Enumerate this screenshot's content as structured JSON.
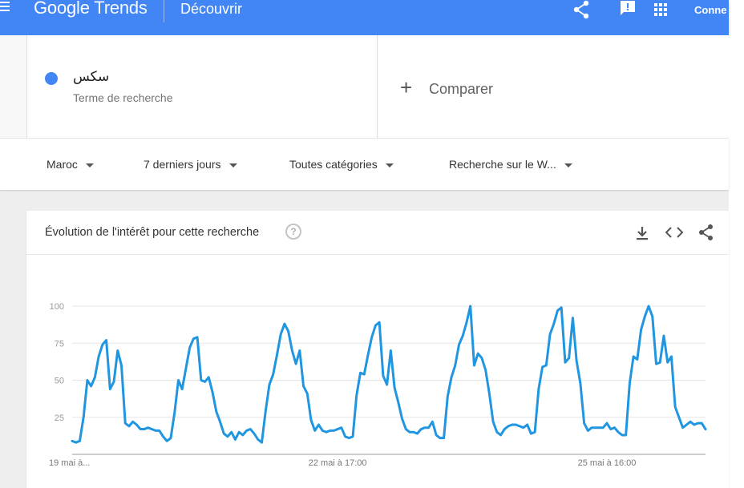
{
  "topbar": {
    "logo_google": "Google",
    "logo_trends": "Trends",
    "section": "Découvrir",
    "connect_label": "Conne",
    "icons": [
      "menu-icon",
      "share-icon",
      "feedback-icon",
      "apps-icon"
    ]
  },
  "term": {
    "name": "سكس",
    "subtitle": "Terme de recherche",
    "color": "#4285f4"
  },
  "compare": {
    "label": "Comparer"
  },
  "filters": [
    {
      "label": "Maroc"
    },
    {
      "label": "7 derniers jours"
    },
    {
      "label": "Toutes catégories"
    },
    {
      "label": "Recherche sur le W..."
    }
  ],
  "card": {
    "title": "Évolution de l'intérêt pour cette recherche",
    "help_label": "?",
    "icons": [
      "download-icon",
      "embed-icon",
      "share-icon"
    ]
  },
  "chart_data": {
    "type": "line",
    "color": "#2196e0",
    "ylim": [
      0,
      100
    ],
    "yticks": [
      25,
      50,
      75,
      100
    ],
    "ytick_labels": [
      "25",
      "50",
      "75",
      "100"
    ],
    "xtick_labels": [
      {
        "label": "19 mai à...",
        "index": 0
      },
      {
        "label": "22 mai à 17:00",
        "index": 70
      },
      {
        "label": "25 mai à 16:00",
        "index": 141
      }
    ],
    "grid": true,
    "values": [
      9,
      8,
      9,
      25,
      50,
      46,
      52,
      66,
      74,
      77,
      44,
      49,
      70,
      60,
      21,
      19,
      22,
      20,
      17,
      17,
      18,
      17,
      16,
      16,
      12,
      9,
      11,
      28,
      50,
      44,
      58,
      72,
      78,
      79,
      50,
      49,
      52,
      42,
      29,
      22,
      14,
      12,
      15,
      10,
      15,
      13,
      16,
      17,
      14,
      10,
      8,
      29,
      47,
      54,
      67,
      81,
      88,
      83,
      70,
      61,
      70,
      46,
      41,
      23,
      16,
      20,
      16,
      15,
      16,
      16,
      17,
      18,
      12,
      11,
      12,
      40,
      55,
      54,
      67,
      79,
      87,
      89,
      53,
      47,
      70,
      45,
      35,
      24,
      17,
      15,
      15,
      14,
      17,
      18,
      18,
      22,
      13,
      11,
      11,
      39,
      52,
      60,
      74,
      80,
      89,
      100,
      60,
      68,
      65,
      57,
      41,
      22,
      15,
      13,
      17,
      19,
      20,
      20,
      19,
      18,
      20,
      14,
      15,
      44,
      59,
      60,
      81,
      88,
      97,
      99,
      62,
      65,
      92,
      63,
      48,
      21,
      16,
      18,
      18,
      18,
      18,
      21,
      17,
      18,
      15,
      13,
      13,
      48,
      66,
      64,
      84,
      93,
      100,
      93,
      61,
      62,
      80,
      62,
      66,
      32,
      25,
      18,
      20,
      22,
      20,
      21,
      21,
      17
    ]
  }
}
